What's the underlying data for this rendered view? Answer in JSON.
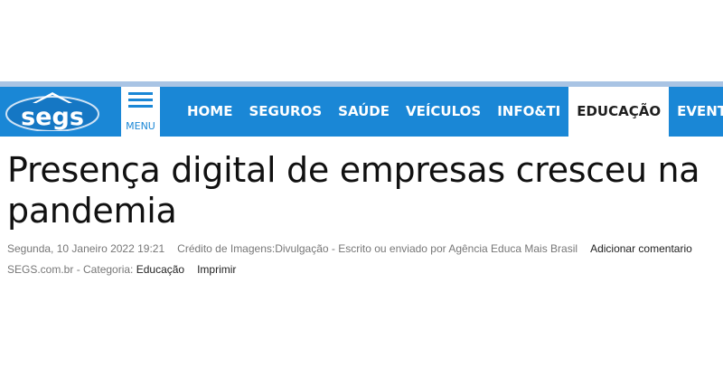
{
  "logo": {
    "text": "segs"
  },
  "menu": {
    "label": "MENU"
  },
  "nav": {
    "items": [
      {
        "label": "HOME"
      },
      {
        "label": "SEGUROS"
      },
      {
        "label": "SAÚDE"
      },
      {
        "label": "VEÍCULOS"
      },
      {
        "label": "INFO&TI"
      },
      {
        "label": "EDUCAÇÃO"
      },
      {
        "label": "EVENT"
      }
    ]
  },
  "article": {
    "title": "Presença digital de empresas cresceu na pandemia",
    "date": "Segunda, 10 Janeiro 2022 19:21",
    "credit": "Crédito de Imagens:Divulgação - Escrito ou enviado por  Agência Educa Mais Brasil",
    "add_comment": "Adicionar comentario",
    "site_category_prefix": "SEGS.com.br - Categoria: ",
    "category": "Educação",
    "print": "Imprimir"
  },
  "colors": {
    "nav_bg": "#1a87d6",
    "active_tab_bg": "#ffffff"
  }
}
